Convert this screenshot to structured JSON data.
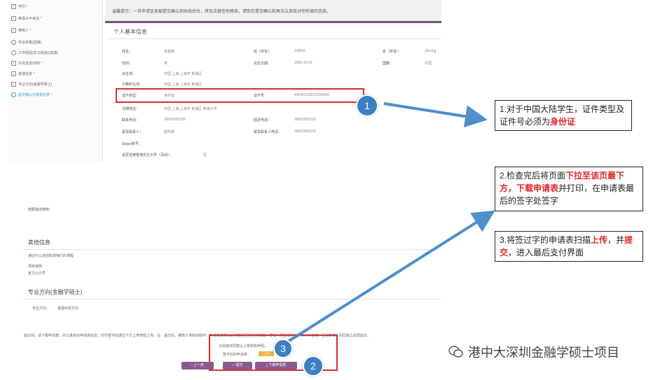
{
  "sidebar": {
    "items": [
      {
        "label": "学历 *",
        "state": "checked"
      },
      {
        "label": "英语水平考试 *",
        "state": "checked"
      },
      {
        "label": "推荐人 *",
        "state": "checked"
      },
      {
        "label": "专业资格(选填)",
        "state": "radio"
      },
      {
        "label": "工作经验(实习经验)(选填)",
        "state": "radio"
      },
      {
        "label": "补充信息/材料 *",
        "state": "checked"
      },
      {
        "label": "其他信息 *",
        "state": "checked"
      },
      {
        "label": "专业方向(金融学硕士)",
        "state": "checked"
      },
      {
        "label": "提交确认并缴报名费 *",
        "state": "active"
      }
    ]
  },
  "notice": "温馨提示：一旦申请信息被提交确认到系统后台，将无法做任何修改，请你在提交确认前再次认真核对你所填的信息。",
  "personal_info": {
    "title": "个人基本信息",
    "name_label": "姓名：",
    "name_value": "张金融",
    "surname_label": "姓（拼音）：",
    "surname_value": "XIANG",
    "given_label": "名（拼音）：",
    "given_value": "Jinrong",
    "gender_label": "性别：",
    "gender_value": "男",
    "birth_label": "出生日期：",
    "birth_value": "1995-10-25",
    "nation_label": "国籍：",
    "nation_value": "中国",
    "birthplace_label": "出生地：",
    "birthplace_value": "中国 上海 上海市 黄浦区",
    "hukou_label": "户籍所在地：",
    "hukou_value": "中国 上海 上海市 黄浦区",
    "cert_type_label": "证件类型：",
    "cert_type_value": "身份证",
    "cert_no_label": "证件号：",
    "cert_no_value": "440302199510250000",
    "contact_addr_label": "详细地址：",
    "contact_addr_value": "中国 上海 上海市 黄浦区 黄浦大学",
    "phone_label": "联系电话：",
    "phone_value": "18652655230",
    "landline_label": "固定电话：",
    "landline_value": "18652655230",
    "emergency_label": "紧急联系人：",
    "emergency_value": "欧阳某",
    "emergency_phone_label": "紧急联系人电话：",
    "emergency_phone_value": "18652655230",
    "skype_label": "Skype账号：",
    "hk_question": "是否曾被香港中文大学（深圳）：",
    "hk_answer": "否"
  },
  "bottom": {
    "reason_label": "简要描述推荐：",
    "other_title": "其他信息",
    "other_q": "通过什么途径知道我们的课程",
    "other_a1": "项目官网",
    "other_a2": "官方公众号",
    "major_title": "专业方向(金融学硕士)",
    "major_label": "专业方向：",
    "major_value": "金融科技方向",
    "declaration": "提交前，请下载申请表，并认真核对申请表信息，打印签字后通过下方上传按钮上传。注：提交后，推荐人将收到邮件，申请信息确认后将发送至报名的邮箱，推荐人员提交的资料将计入正确，且和推荐人的同意之后再提交。",
    "declaration2": "已阅读并同意以上条款和声明。",
    "sig_label": "签字后的申请表：",
    "sig_upload": "上传",
    "prev_label": "上一步",
    "submit_label": "提交",
    "download_label": "下载申请表"
  },
  "markers": {
    "m1": "1",
    "m2": "2",
    "m3": "3"
  },
  "callouts": {
    "c1_pre": "1.对于中国大陆学生，证件类型及证件号必须为",
    "c1_em": "身份证",
    "c2_pre": "2.检查完后将页面",
    "c2_em1": "下拉至该页最下方，下载申请表",
    "c2_mid": "并打印，在申请表最后的签字处签字",
    "c3_pre": "3.将签过字的申请表扫描",
    "c3_em1": "上传",
    "c3_mid": "，并",
    "c3_em2": "提交",
    "c3_post": "，进入最后支付界面"
  },
  "watermark": "港中大深圳金融学硕士项目",
  "colors": {
    "accent": "#7a4f7f",
    "marker": "#3d7fc3",
    "highlight": "#d22f33",
    "arrow": "#4e8fcc"
  }
}
